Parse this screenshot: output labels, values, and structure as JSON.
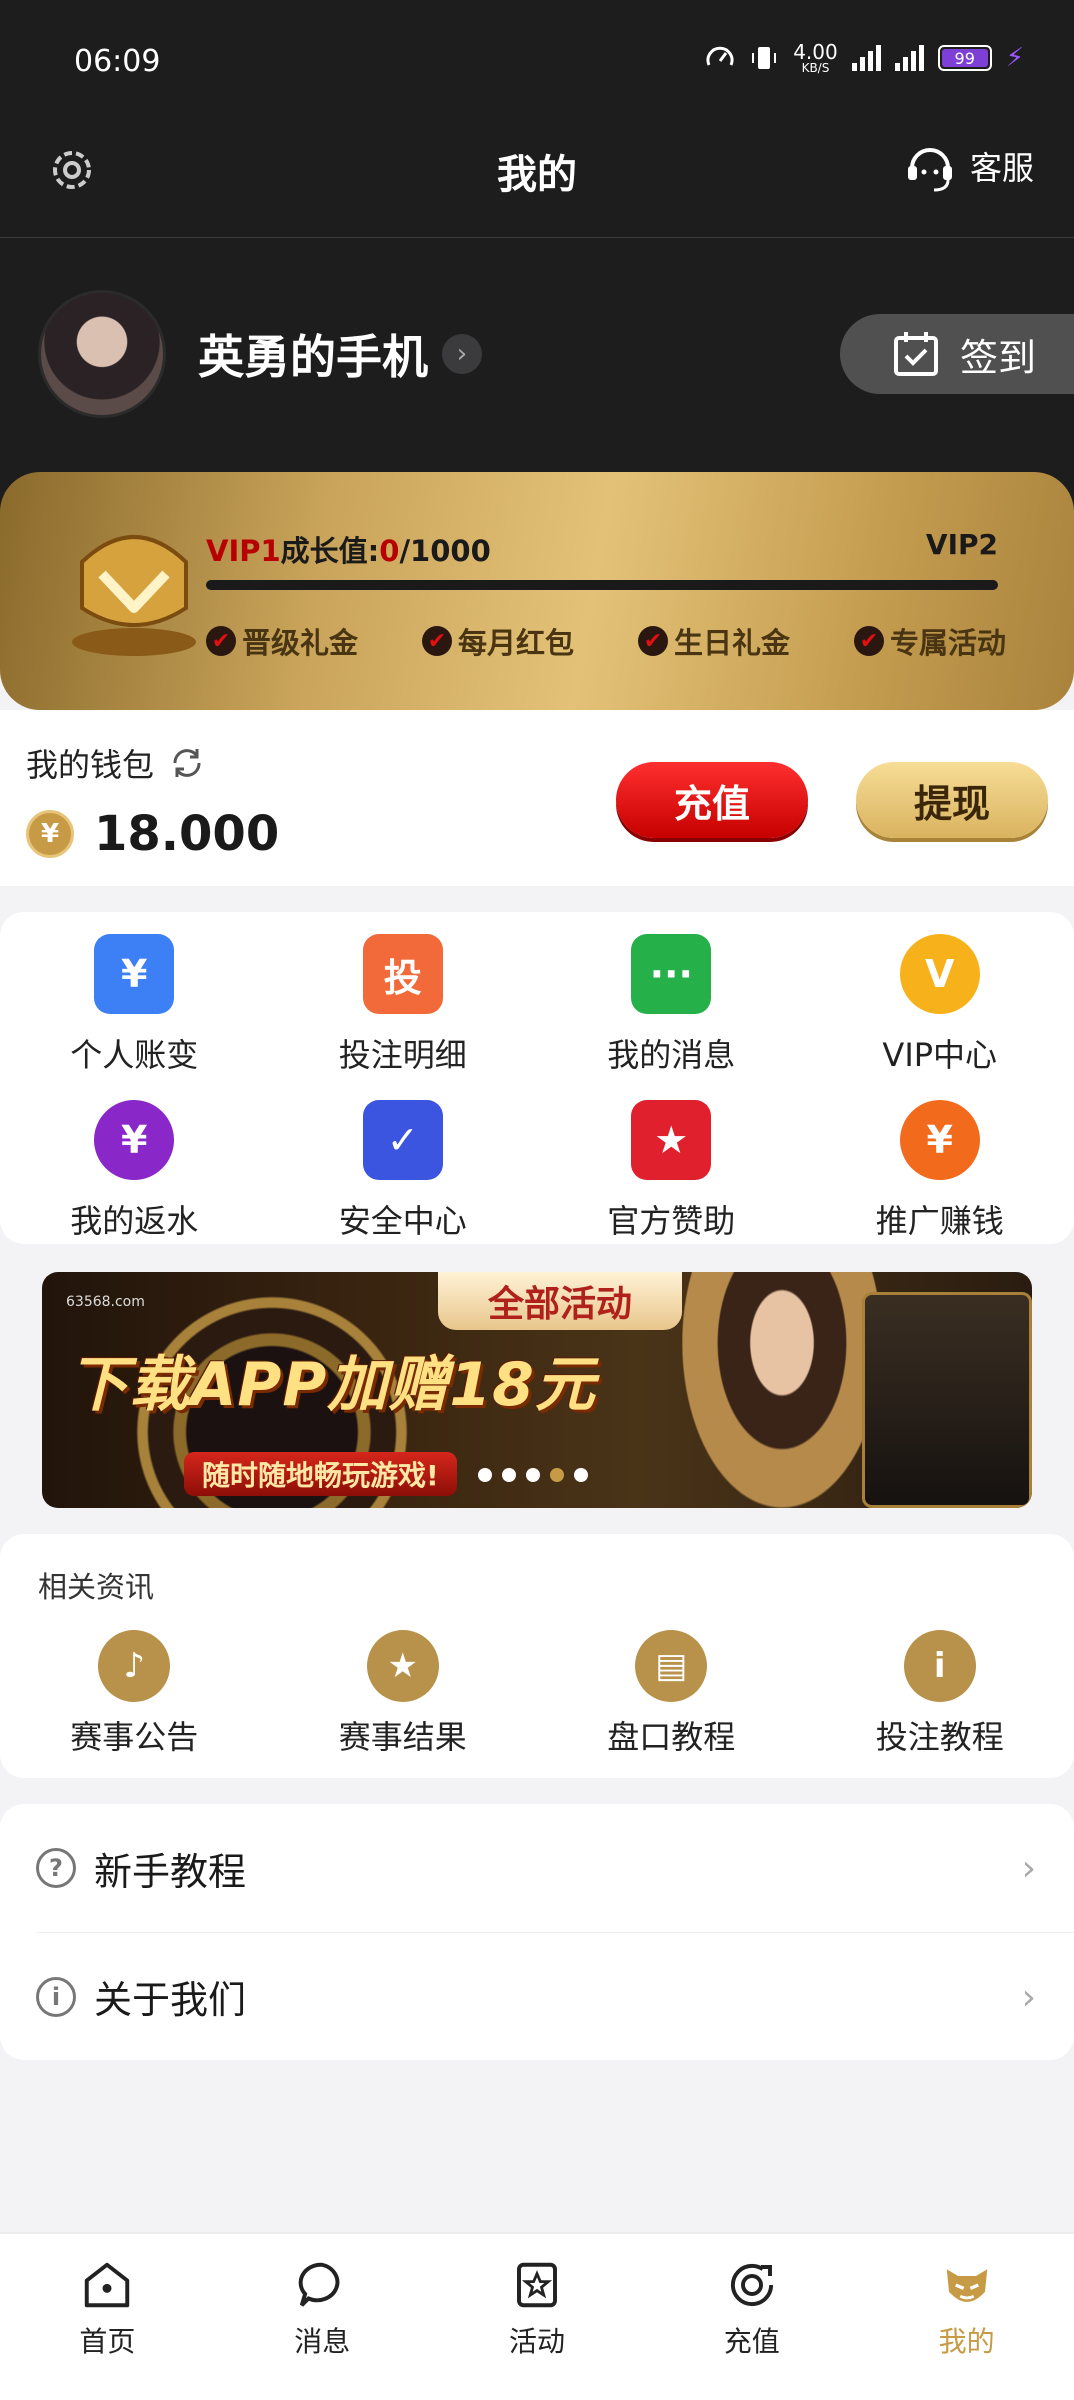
{
  "status": {
    "time": "06:09",
    "speed": "4.00",
    "speed_unit": "KB/S",
    "battery": "99"
  },
  "header": {
    "title": "我的",
    "service_label": "客服"
  },
  "profile": {
    "username": "英勇的手机",
    "checkin_label": "签到"
  },
  "vip": {
    "current": "VIP1",
    "growth_label": "成长值:",
    "growth_value": "0",
    "growth_total": "/1000",
    "next": "VIP2",
    "progress": 0,
    "perks": [
      "晋级礼金",
      "每月红包",
      "生日礼金",
      "专属活动"
    ]
  },
  "wallet": {
    "label": "我的钱包",
    "amount": "18.000",
    "currency_symbol": "¥",
    "recharge_label": "充值",
    "withdraw_label": "提现"
  },
  "features": [
    {
      "label": "个人账变",
      "icon": "account-change-icon",
      "color": "#3d7ff5",
      "glyph": "¥"
    },
    {
      "label": "投注明细",
      "icon": "bet-detail-icon",
      "color": "#f26a3a",
      "glyph": "投"
    },
    {
      "label": "我的消息",
      "icon": "message-icon",
      "color": "#25b04a",
      "glyph": "···"
    },
    {
      "label": "VIP中心",
      "icon": "vip-crown-icon",
      "color": "#f7b21b",
      "glyph": "V"
    },
    {
      "label": "我的返水",
      "icon": "rebate-icon",
      "color": "#8a27c9",
      "glyph": "¥"
    },
    {
      "label": "安全中心",
      "icon": "shield-icon",
      "color": "#3b55e0",
      "glyph": "✓"
    },
    {
      "label": "官方赞助",
      "icon": "sponsor-star-icon",
      "color": "#e0202c",
      "glyph": "★"
    },
    {
      "label": "推广赚钱",
      "icon": "promote-coin-icon",
      "color": "#f26a1b",
      "glyph": "¥"
    }
  ],
  "banner": {
    "tag": "全部活动",
    "title": "下载APP加赠18元",
    "subtitle": "随时随地畅玩游戏!",
    "logo": "63568.com",
    "slides": 5,
    "active_slide": 3
  },
  "news": {
    "title": "相关资讯",
    "items": [
      {
        "label": "赛事公告",
        "icon": "bell-icon",
        "glyph": "♪"
      },
      {
        "label": "赛事结果",
        "icon": "trophy-icon",
        "glyph": "★"
      },
      {
        "label": "盘口教程",
        "icon": "book-icon",
        "glyph": "▤"
      },
      {
        "label": "投注教程",
        "icon": "info-icon",
        "glyph": "i"
      }
    ]
  },
  "list": [
    {
      "label": "新手教程",
      "icon": "question-icon",
      "glyph": "?"
    },
    {
      "label": "关于我们",
      "icon": "info-circle-icon",
      "glyph": "i"
    }
  ],
  "nav": [
    {
      "label": "首页",
      "icon": "home-icon",
      "active": false
    },
    {
      "label": "消息",
      "icon": "chat-icon",
      "active": false
    },
    {
      "label": "活动",
      "icon": "activity-star-icon",
      "active": false
    },
    {
      "label": "充值",
      "icon": "recharge-icon",
      "active": false
    },
    {
      "label": "我的",
      "icon": "mine-icon",
      "active": true
    }
  ],
  "colors": {
    "accent_gold": "#c79b45",
    "red": "#c60000",
    "dark_bg": "#1d1d1e"
  }
}
